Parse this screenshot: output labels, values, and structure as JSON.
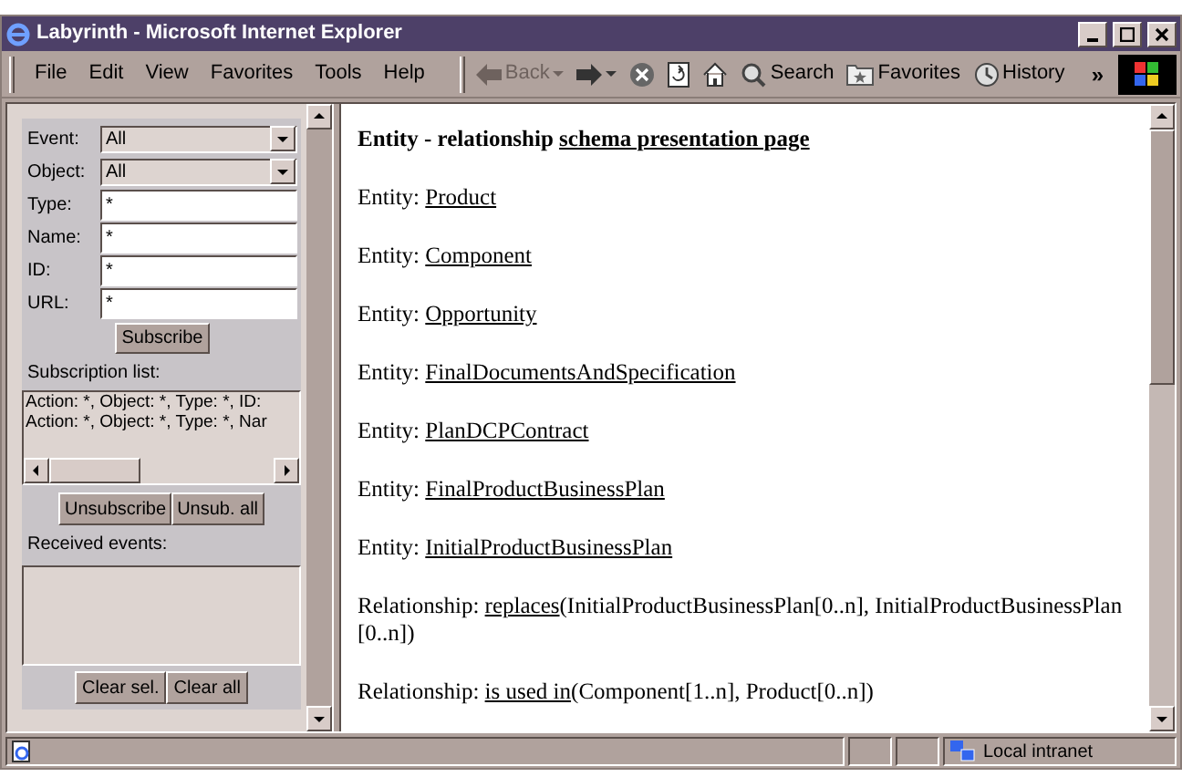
{
  "window": {
    "title": "Labyrinth - Microsoft Internet Explorer"
  },
  "menu": [
    "File",
    "Edit",
    "View",
    "Favorites",
    "Tools",
    "Help"
  ],
  "toolbar": [
    {
      "kind": "back",
      "label": "Back",
      "disabled": true
    },
    {
      "kind": "forward",
      "disabled": false
    },
    {
      "kind": "stop",
      "disabled": false
    },
    {
      "kind": "refresh",
      "disabled": false
    },
    {
      "kind": "home",
      "disabled": false
    },
    {
      "kind": "search",
      "label": "Search",
      "disabled": false
    },
    {
      "kind": "favorites",
      "label": "Favorites",
      "disabled": false
    },
    {
      "kind": "history",
      "label": "History",
      "disabled": false
    }
  ],
  "toolbar_overflow": "»",
  "subscribe_form": {
    "fields": [
      {
        "kind": "select",
        "label": "Event:",
        "value": "All"
      },
      {
        "kind": "select",
        "label": "Object:",
        "value": "All"
      },
      {
        "kind": "text",
        "label": "Type:",
        "value": "*"
      },
      {
        "kind": "text",
        "label": "Name:",
        "value": "*"
      },
      {
        "kind": "text",
        "label": "ID:",
        "value": "*"
      },
      {
        "kind": "text",
        "label": "URL:",
        "value": "*"
      }
    ],
    "subscribe_button": "Subscribe",
    "subscription_list_label": "Subscription list:",
    "subscriptions": [
      "Action: *, Object: *, Type: *, ID:",
      "Action: *, Object: *, Type: *, Nar"
    ],
    "list_buttons": [
      "Unsubscribe",
      "Unsub. all"
    ],
    "received_label": "Received events:",
    "received_buttons": [
      "Clear sel.",
      "Clear all"
    ]
  },
  "page": {
    "heading": {
      "text": "Entity - relationship ",
      "link": "schema presentation page"
    },
    "lines": [
      {
        "prefix": "Entity: ",
        "link": "Product"
      },
      {
        "prefix": "Entity: ",
        "link": "Component"
      },
      {
        "prefix": "Entity: ",
        "link": "Opportunity"
      },
      {
        "prefix": "Entity: ",
        "link": "FinalDocumentsAndSpecification"
      },
      {
        "prefix": "Entity: ",
        "link": "PlanDCPContract"
      },
      {
        "prefix": "Entity: ",
        "link": "FinalProductBusinessPlan"
      },
      {
        "prefix": "Entity: ",
        "link": "InitialProductBusinessPlan"
      },
      {
        "prefix": "Relationship: ",
        "link": "replaces",
        "suffix": "(InitialProductBusinessPlan[0..n], InitialProductBusinessPlan [0..n])"
      },
      {
        "prefix": "Relationship: ",
        "link": "is used in",
        "suffix": "(Component[1..n], Product[0..n])"
      }
    ]
  },
  "status_bar": {
    "zone": "Local intranet"
  }
}
